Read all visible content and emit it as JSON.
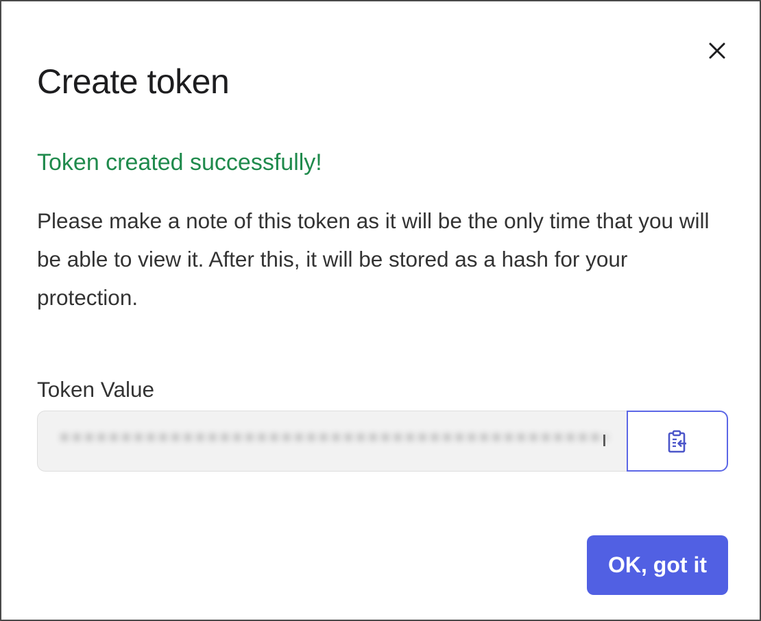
{
  "dialog": {
    "title": "Create token",
    "success_message": "Token created successfully!",
    "note": "Please make a note of this token as it will be the only time that you will be able to view it. After this, it will be stored as a hash for your protection.",
    "close_icon": "close-icon",
    "token_field": {
      "label": "Token Value",
      "value": "•••••••••••••••••••••••••••••••••••••••••••••",
      "value_is_obscured": true,
      "copy_icon": "clipboard-paste-icon"
    },
    "confirm_button_label": "OK, got it"
  },
  "colors": {
    "success_text": "#1f8a4c",
    "accent": "#5160e3",
    "copy_button_border": "#5b66e6",
    "input_background": "#f2f2f2",
    "title_text": "#1d1d1f",
    "body_text": "#333333"
  }
}
